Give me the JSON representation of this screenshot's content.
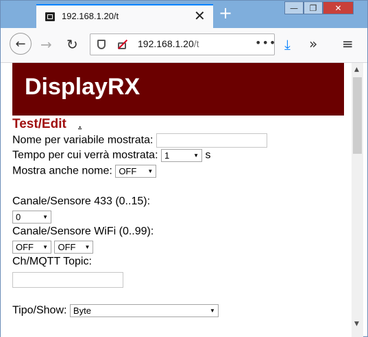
{
  "browser": {
    "tab_title": "192.168.1.20/t",
    "tab_close": "✕",
    "new_tab": "+",
    "url_host": "192.168.1.20",
    "url_path": "/t",
    "url_more": "•••",
    "window_min": "—",
    "window_max": "❐",
    "window_close": "✕",
    "back": "←",
    "forward": "→",
    "reload": "↻",
    "download": "⤓",
    "overflow": "»",
    "menu": "≡",
    "scroll_up": "▲",
    "scroll_down": "▼"
  },
  "page": {
    "banner_title": "DisplayRX",
    "section_title": "Test/Edit",
    "section_link": ".",
    "fields": {
      "name_label": "Nome per variabile mostrata:",
      "name_value": "",
      "duration_label": "Tempo per cui verrà mostrata:",
      "duration_value": "1",
      "duration_unit": "s",
      "show_name_label": "Mostra anche nome:",
      "show_name_value": "OFF",
      "sensor433_label": "Canale/Sensore 433 (0..15):",
      "sensor433_value": "0",
      "wifi_label": "Canale/Sensore WiFi (0..99):",
      "wifi_value_1": "OFF",
      "wifi_value_2": "OFF",
      "mqtt_label": "Ch/MQTT Topic:",
      "mqtt_value": "",
      "type_label": "Tipo/Show:",
      "type_value": "Byte"
    }
  }
}
